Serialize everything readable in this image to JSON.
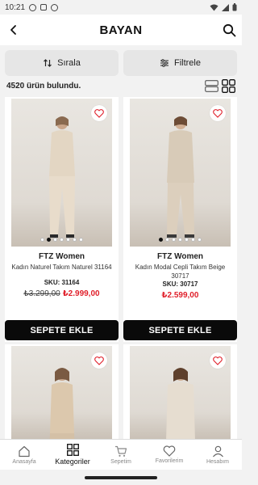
{
  "status_bar": {
    "time": "10:21"
  },
  "header": {
    "title": "BAYAN"
  },
  "controls": {
    "sort_label": "Sırala",
    "filter_label": "Filtrele"
  },
  "results": {
    "count_text": "4520 ürün bulundu."
  },
  "products": [
    {
      "brand": "FTZ Women",
      "name": "Kadın Naturel Takım Naturel 31164",
      "sku": "SKU: 31164",
      "old_price": "₺3.299,00",
      "price": "₺2.999,00",
      "button": "SEPETE EKLE",
      "image_dots": 7,
      "active_dot": 1
    },
    {
      "brand": "FTZ Women",
      "name": "Kadın Modal Cepli Takım Beige 30717",
      "sku": "SKU: 30717",
      "old_price": "",
      "price": "₺2.599,00",
      "button": "SEPETE EKLE",
      "image_dots": 7,
      "active_dot": 0
    },
    {
      "brand": "",
      "name": "",
      "sku": "",
      "old_price": "",
      "price": "",
      "button": ""
    },
    {
      "brand": "",
      "name": "",
      "sku": "",
      "old_price": "",
      "price": "",
      "button": ""
    }
  ],
  "bottom_nav": {
    "items": [
      {
        "label": "Anasayfa",
        "icon": "home-icon"
      },
      {
        "label": "Kategoriler",
        "icon": "grid-icon"
      },
      {
        "label": "Sepetim",
        "icon": "cart-icon"
      },
      {
        "label": "Favorilerim",
        "icon": "heart-icon"
      },
      {
        "label": "Hesabım",
        "icon": "user-icon"
      }
    ],
    "active": "Kategoriler"
  },
  "colors": {
    "price_red": "#e0202b",
    "button_black": "#0a0a0a",
    "background": "#f2f2f2"
  }
}
